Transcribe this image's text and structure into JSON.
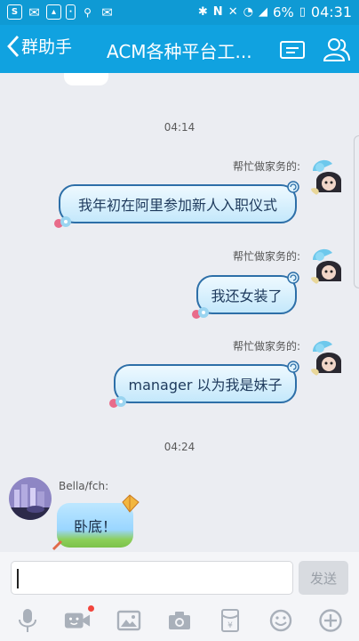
{
  "status_bar": {
    "left_icons": [
      "s-app-icon",
      "mail-icon",
      "gallery-icon",
      "phone-icon",
      "vpn-icon",
      "mail-icon"
    ],
    "battery": "6%",
    "time": "04:31"
  },
  "header": {
    "back_label": "群助手",
    "title": "ACM各种平台工...",
    "bg_color": "#10a2e0"
  },
  "chat": {
    "messages": [
      {
        "time": "04:14"
      },
      {
        "sender": "帮忙做家务的:",
        "text": "我年初在阿里参加新人入职仪式",
        "side": "right"
      },
      {
        "sender": "帮忙做家务的:",
        "text": "我还女装了",
        "side": "right"
      },
      {
        "sender": "帮忙做家务的:",
        "text": "manager 以为我是妹子",
        "side": "right"
      },
      {
        "time": "04:24"
      },
      {
        "sender": "Bella/fch:",
        "text": "卧底！",
        "side": "left"
      }
    ]
  },
  "input": {
    "value": "",
    "send_label": "发送"
  },
  "toolbar": {
    "icons": [
      "microphone-icon",
      "video-icon",
      "image-icon",
      "camera-icon",
      "red-packet-icon",
      "emoji-icon",
      "plus-icon"
    ]
  }
}
